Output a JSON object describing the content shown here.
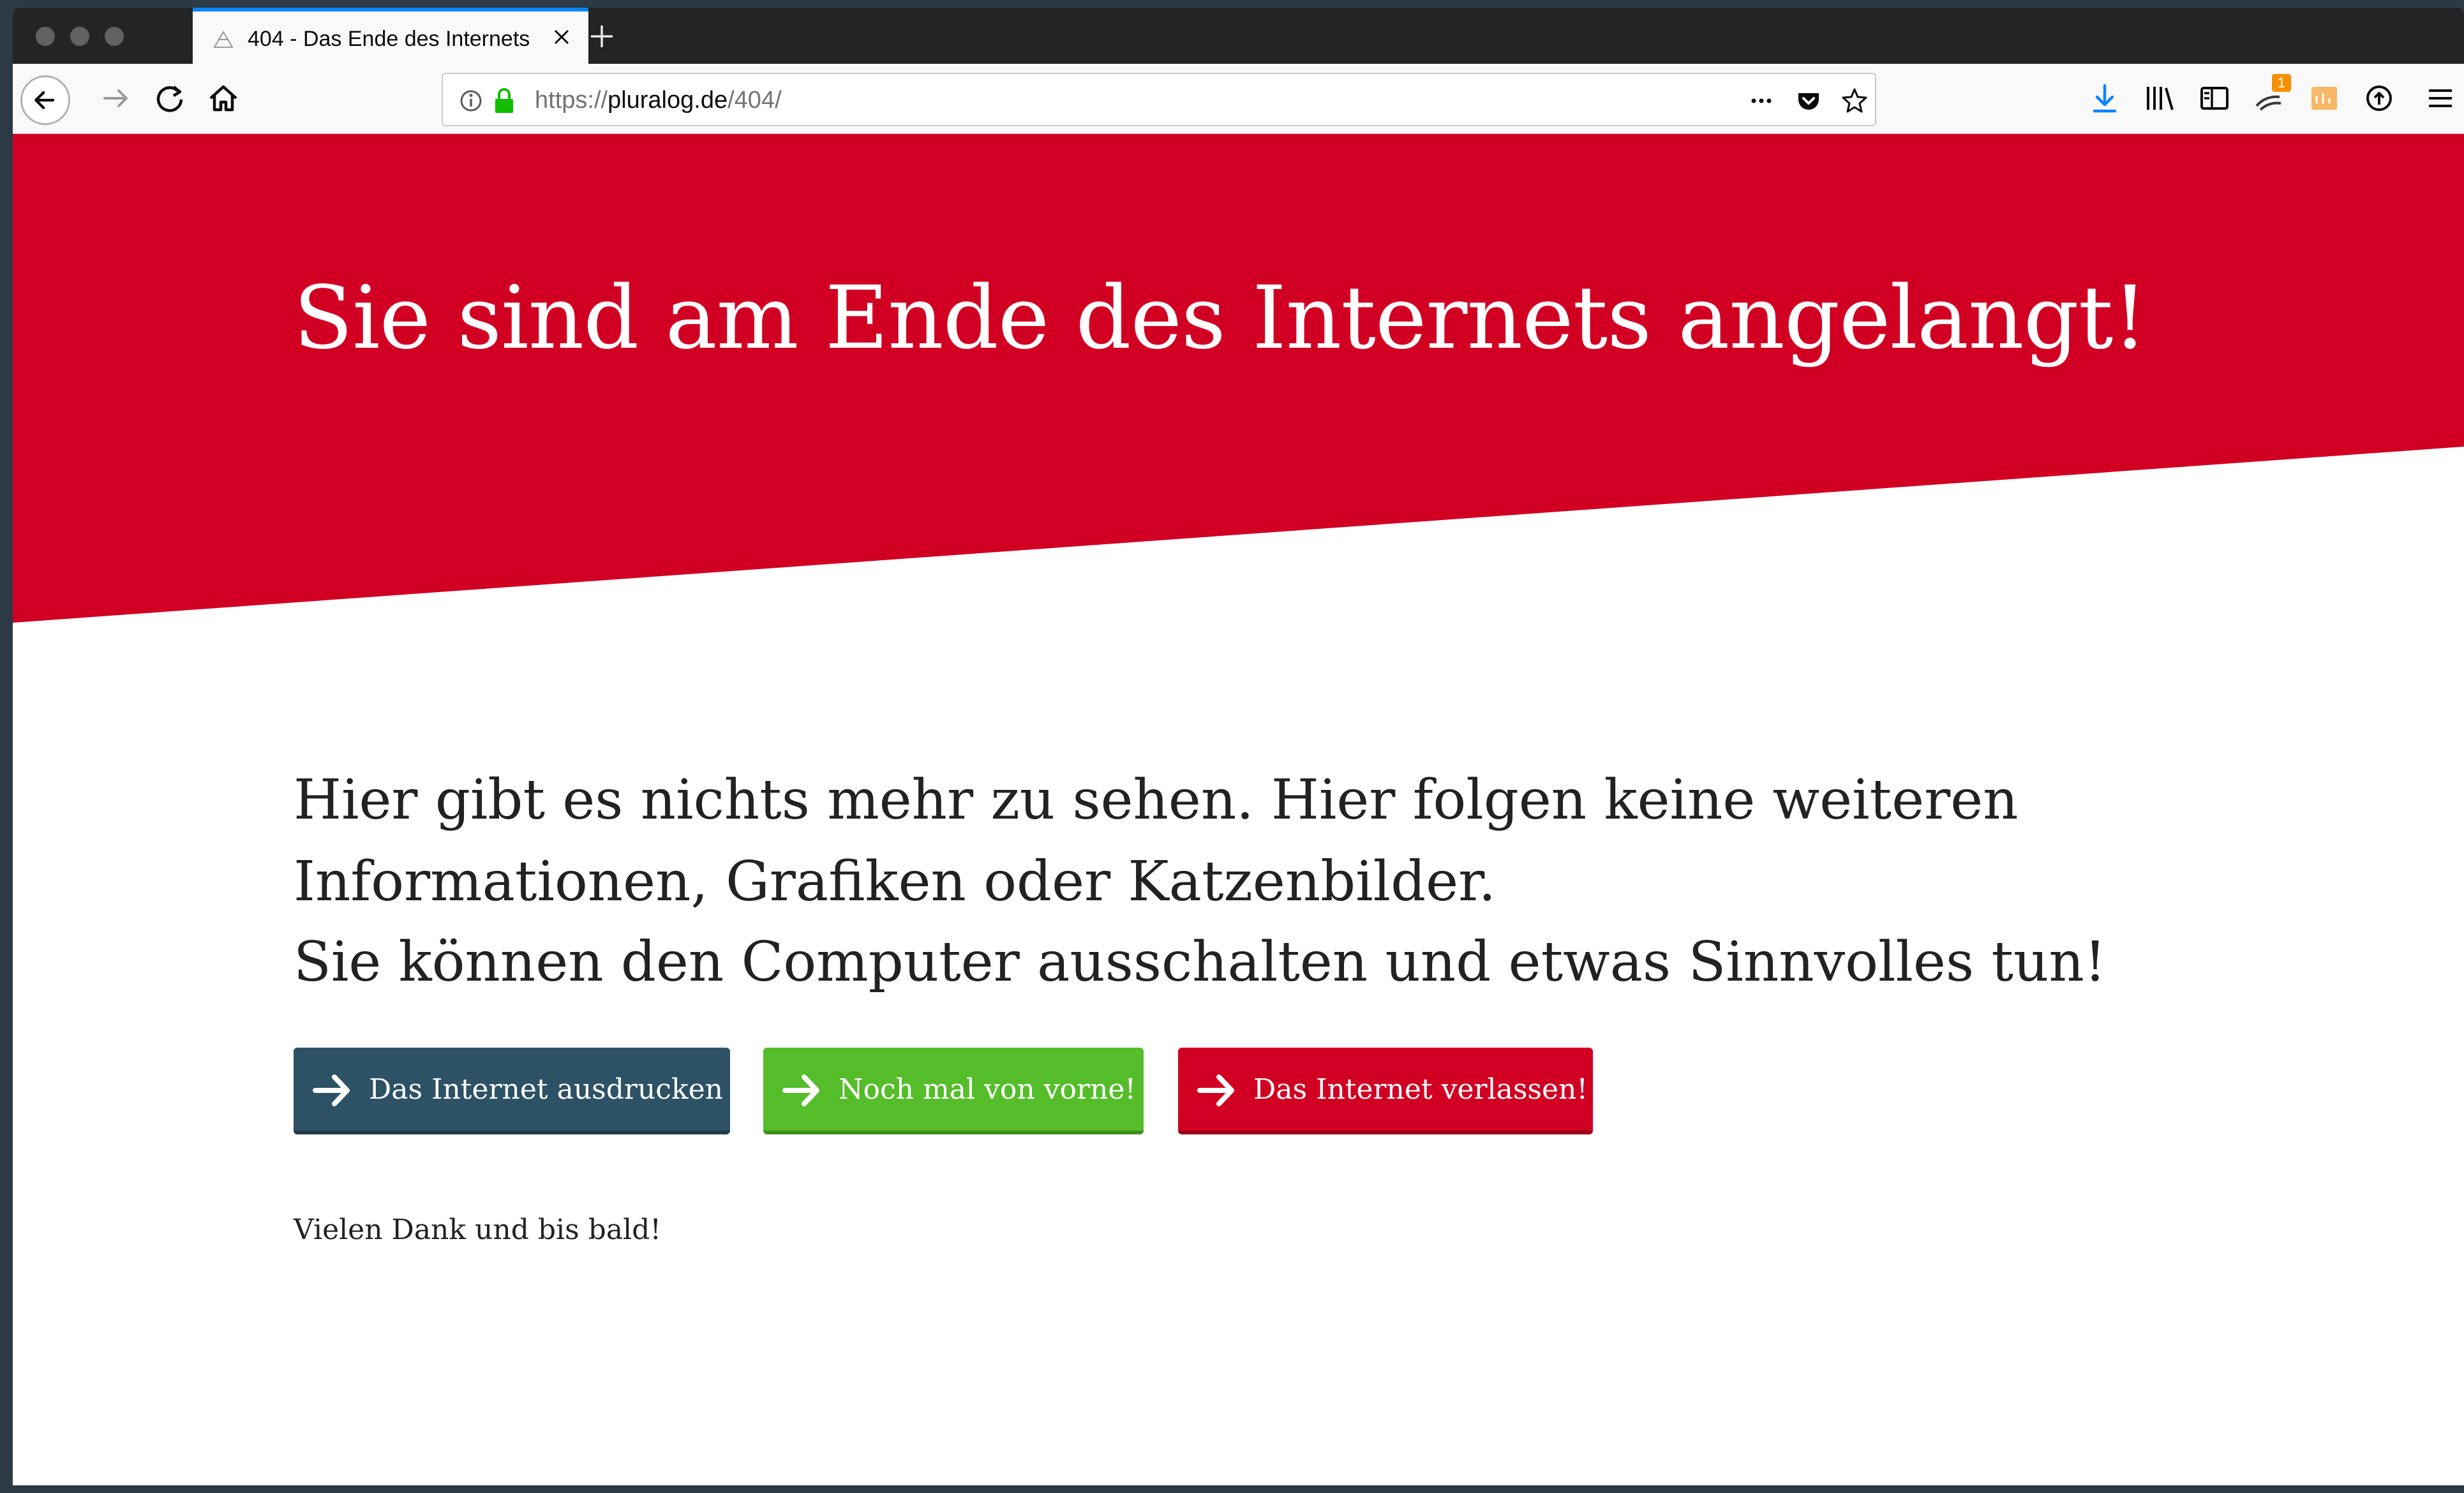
{
  "browser": {
    "tab": {
      "title": "404 - Das Ende des Internets"
    },
    "url": {
      "scheme": "https://",
      "host": "pluralog.de",
      "path": "/404/"
    },
    "notification_badge": "1"
  },
  "page": {
    "hero_title": "Sie sind am Ende des Internets angelangt!",
    "lead_line1": "Hier gibt es nichts mehr zu sehen. Hier folgen keine weiteren Informationen, Grafiken oder Katzenbilder.",
    "lead_line2": "Sie können den Computer ausschalten und etwas Sinnvolles tun!",
    "buttons": [
      {
        "label": "Das Internet ausdrucken",
        "color": "#2d5165"
      },
      {
        "label": "Noch mal von vorne!",
        "color": "#55bd2a"
      },
      {
        "label": "Das Internet verlassen!",
        "color": "#d10023"
      }
    ],
    "footer_text": "Vielen Dank und bis bald!",
    "hero_color": "#d10023"
  }
}
